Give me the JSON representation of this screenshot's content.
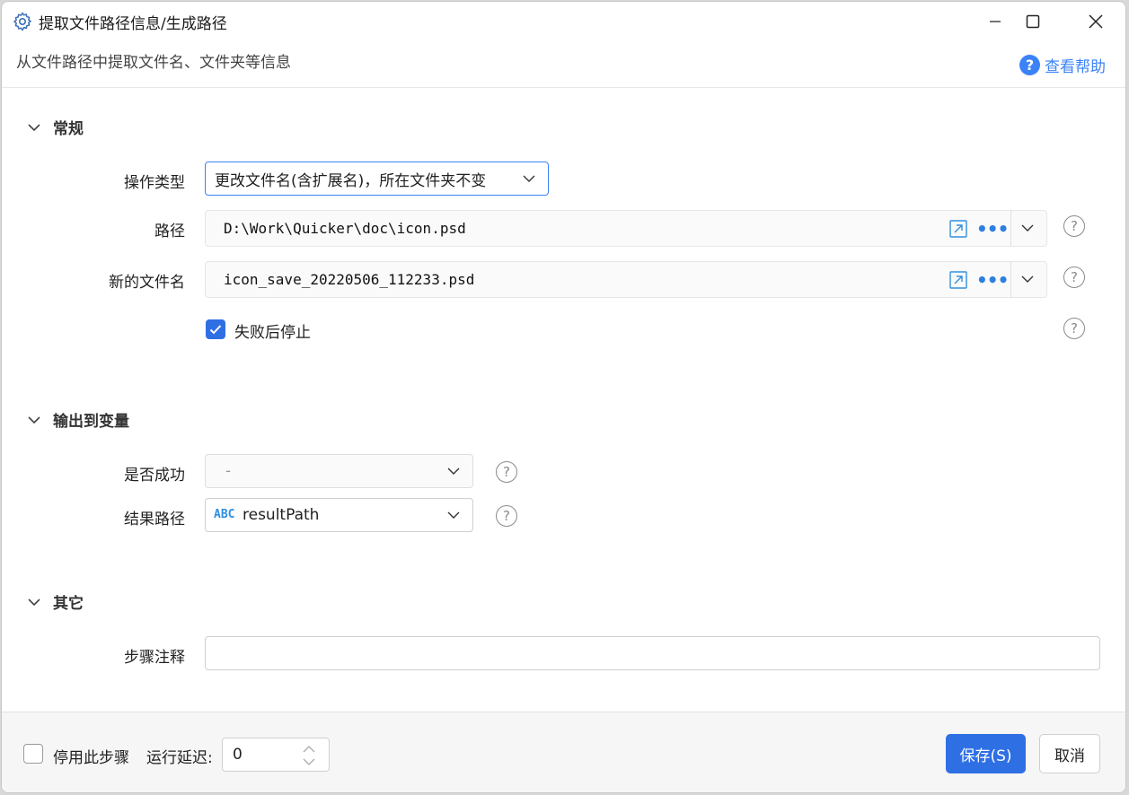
{
  "window": {
    "title": "提取文件路径信息/生成路径",
    "subtitle": "从文件路径中提取文件名、文件夹等信息",
    "help_label": "查看帮助"
  },
  "sections": {
    "general": "常规",
    "output": "输出到变量",
    "other": "其它"
  },
  "general": {
    "op_type_label": "操作类型",
    "op_type_value": "更改文件名(含扩展名)，所在文件夹不变",
    "path_label": "路径",
    "path_value": "D:\\Work\\Quicker\\doc\\icon.psd",
    "newname_label": "新的文件名",
    "newname_value": "icon_save_20220506_112233.psd",
    "stop_on_fail_label": "失败后停止",
    "stop_on_fail_checked": true
  },
  "output": {
    "success_label": "是否成功",
    "success_value": "-",
    "result_label": "结果路径",
    "result_type_badge": "ABC",
    "result_value": "resultPath"
  },
  "other": {
    "note_label": "步骤注释",
    "note_value": ""
  },
  "footer": {
    "disable_label": "停用此步骤",
    "delay_label": "运行延迟:",
    "delay_value": "0",
    "save_label": "保存(S)",
    "cancel_label": "取消"
  },
  "colors": {
    "accent": "#2f6fe4",
    "link": "#3b82f6"
  },
  "icons": [
    "gear-icon",
    "minimize-icon",
    "maximize-icon",
    "close-icon",
    "help-icon",
    "chevron-down-icon",
    "open-external-icon",
    "more-icon",
    "question-icon",
    "checkmark-icon",
    "spinner-arrows-icon"
  ]
}
